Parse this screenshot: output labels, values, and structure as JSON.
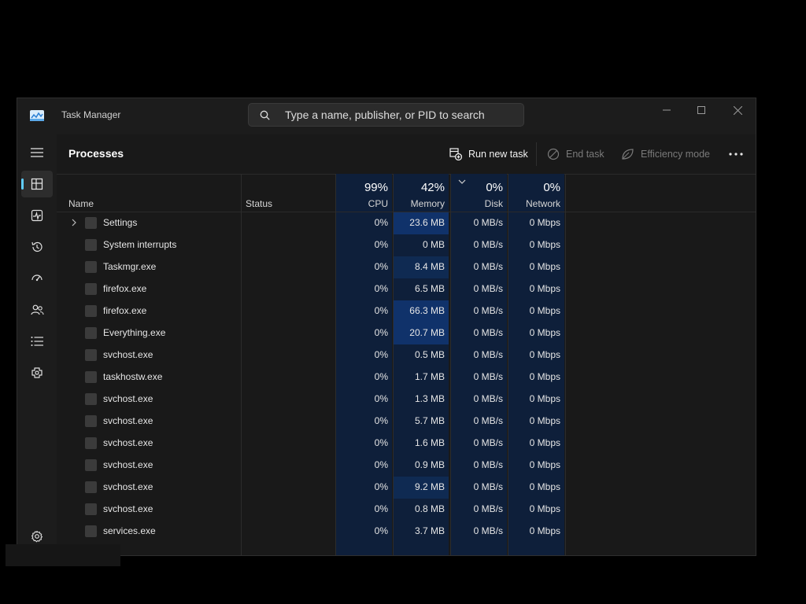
{
  "window": {
    "title": "Task Manager"
  },
  "search": {
    "placeholder": "Type a name, publisher, or PID to search"
  },
  "sidebar": {
    "items": [
      "hamburger-menu",
      "processes",
      "performance",
      "app-history",
      "startup-apps",
      "users",
      "details",
      "services",
      "settings"
    ]
  },
  "commandbar": {
    "page_title": "Processes",
    "run_new_task": "Run new task",
    "end_task": "End task",
    "efficiency_mode": "Efficiency mode"
  },
  "columns": {
    "name": "Name",
    "status": "Status",
    "cpu": {
      "label": "CPU",
      "pct": "99%"
    },
    "memory": {
      "label": "Memory",
      "pct": "42%"
    },
    "disk": {
      "label": "Disk",
      "pct": "0%"
    },
    "network": {
      "label": "Network",
      "pct": "0%"
    }
  },
  "colors": {
    "accent": "#60cdff",
    "heat_low": "#0f2a52",
    "heat_mid": "#10326a",
    "col_bg": "#0e1f3a"
  },
  "processes": [
    {
      "name": "Settings",
      "expandable": true,
      "cpu": "0%",
      "memory": "23.6 MB",
      "mem_heat": 2,
      "disk": "0 MB/s",
      "network": "0 Mbps"
    },
    {
      "name": "System interrupts",
      "expandable": false,
      "cpu": "0%",
      "memory": "0 MB",
      "mem_heat": 0,
      "disk": "0 MB/s",
      "network": "0 Mbps"
    },
    {
      "name": "Taskmgr.exe",
      "expandable": false,
      "cpu": "0%",
      "memory": "8.4 MB",
      "mem_heat": 1,
      "disk": "0 MB/s",
      "network": "0 Mbps"
    },
    {
      "name": "firefox.exe",
      "expandable": false,
      "cpu": "0%",
      "memory": "6.5 MB",
      "mem_heat": 0,
      "disk": "0 MB/s",
      "network": "0 Mbps"
    },
    {
      "name": "firefox.exe",
      "expandable": false,
      "cpu": "0%",
      "memory": "66.3 MB",
      "mem_heat": 2,
      "disk": "0 MB/s",
      "network": "0 Mbps"
    },
    {
      "name": "Everything.exe",
      "expandable": false,
      "cpu": "0%",
      "memory": "20.7 MB",
      "mem_heat": 2,
      "disk": "0 MB/s",
      "network": "0 Mbps"
    },
    {
      "name": "svchost.exe",
      "expandable": false,
      "cpu": "0%",
      "memory": "0.5 MB",
      "mem_heat": 0,
      "disk": "0 MB/s",
      "network": "0 Mbps"
    },
    {
      "name": "taskhostw.exe",
      "expandable": false,
      "cpu": "0%",
      "memory": "1.7 MB",
      "mem_heat": 0,
      "disk": "0 MB/s",
      "network": "0 Mbps"
    },
    {
      "name": "svchost.exe",
      "expandable": false,
      "cpu": "0%",
      "memory": "1.3 MB",
      "mem_heat": 0,
      "disk": "0 MB/s",
      "network": "0 Mbps"
    },
    {
      "name": "svchost.exe",
      "expandable": false,
      "cpu": "0%",
      "memory": "5.7 MB",
      "mem_heat": 0,
      "disk": "0 MB/s",
      "network": "0 Mbps"
    },
    {
      "name": "svchost.exe",
      "expandable": false,
      "cpu": "0%",
      "memory": "1.6 MB",
      "mem_heat": 0,
      "disk": "0 MB/s",
      "network": "0 Mbps"
    },
    {
      "name": "svchost.exe",
      "expandable": false,
      "cpu": "0%",
      "memory": "0.9 MB",
      "mem_heat": 0,
      "disk": "0 MB/s",
      "network": "0 Mbps"
    },
    {
      "name": "svchost.exe",
      "expandable": false,
      "cpu": "0%",
      "memory": "9.2 MB",
      "mem_heat": 1,
      "disk": "0 MB/s",
      "network": "0 Mbps"
    },
    {
      "name": "svchost.exe",
      "expandable": false,
      "cpu": "0%",
      "memory": "0.8 MB",
      "mem_heat": 0,
      "disk": "0 MB/s",
      "network": "0 Mbps"
    },
    {
      "name": "services.exe",
      "expandable": false,
      "cpu": "0%",
      "memory": "3.7 MB",
      "mem_heat": 0,
      "disk": "0 MB/s",
      "network": "0 Mbps"
    }
  ]
}
